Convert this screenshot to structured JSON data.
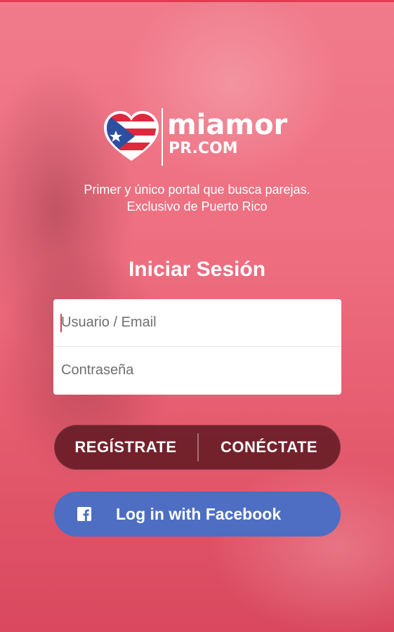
{
  "brand": {
    "name": "miamor",
    "domain": "PR.COM"
  },
  "tagline": {
    "line1": "Primer y único portal que busca parejas.",
    "line2": "Exclusivo de Puerto Rico"
  },
  "login": {
    "title": "Iniciar Sesión",
    "username_placeholder": "Usuario / Email",
    "password_placeholder": "Contraseña",
    "username_value": "",
    "password_value": ""
  },
  "actions": {
    "register_label": "REGÍSTRATE",
    "connect_label": "CONÉCTATE",
    "facebook_label": "Log in with Facebook"
  },
  "icons": {
    "logo": "puerto-rico-flag-heart-icon",
    "facebook": "facebook-icon"
  },
  "colors": {
    "accent": "#e23a52",
    "facebook": "#4d6ec2",
    "button_dark": "#5a161e",
    "background": "#ee6e80"
  }
}
